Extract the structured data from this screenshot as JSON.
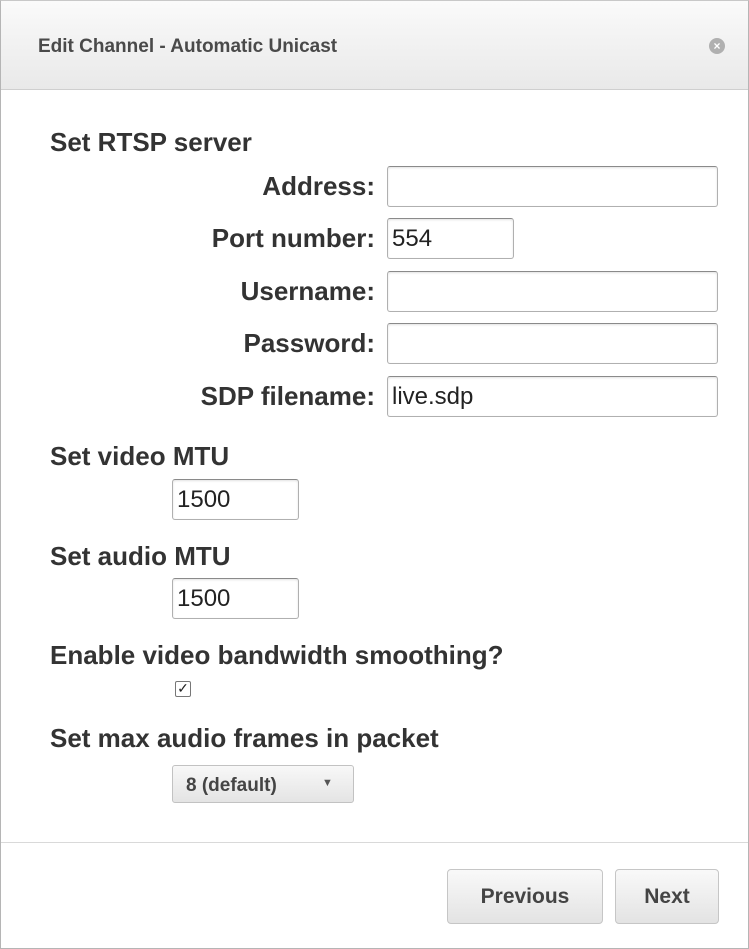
{
  "dialog": {
    "title": "Edit Channel - Automatic Unicast",
    "close_icon": "close-icon"
  },
  "rtsp": {
    "heading": "Set RTSP server",
    "address_label": "Address:",
    "address_value": "",
    "port_label": "Port number:",
    "port_value": "554",
    "username_label": "Username:",
    "username_value": "",
    "password_label": "Password:",
    "password_value": "",
    "sdp_label": "SDP filename:",
    "sdp_value": "live.sdp"
  },
  "video_mtu": {
    "heading": "Set video MTU",
    "value": "1500"
  },
  "audio_mtu": {
    "heading": "Set audio MTU",
    "value": "1500"
  },
  "smoothing": {
    "heading": "Enable video bandwidth smoothing?",
    "checked": true
  },
  "audio_frames": {
    "heading": "Set max audio frames in packet",
    "selected": "8 (default)"
  },
  "buttons": {
    "previous": "Previous",
    "next": "Next"
  }
}
